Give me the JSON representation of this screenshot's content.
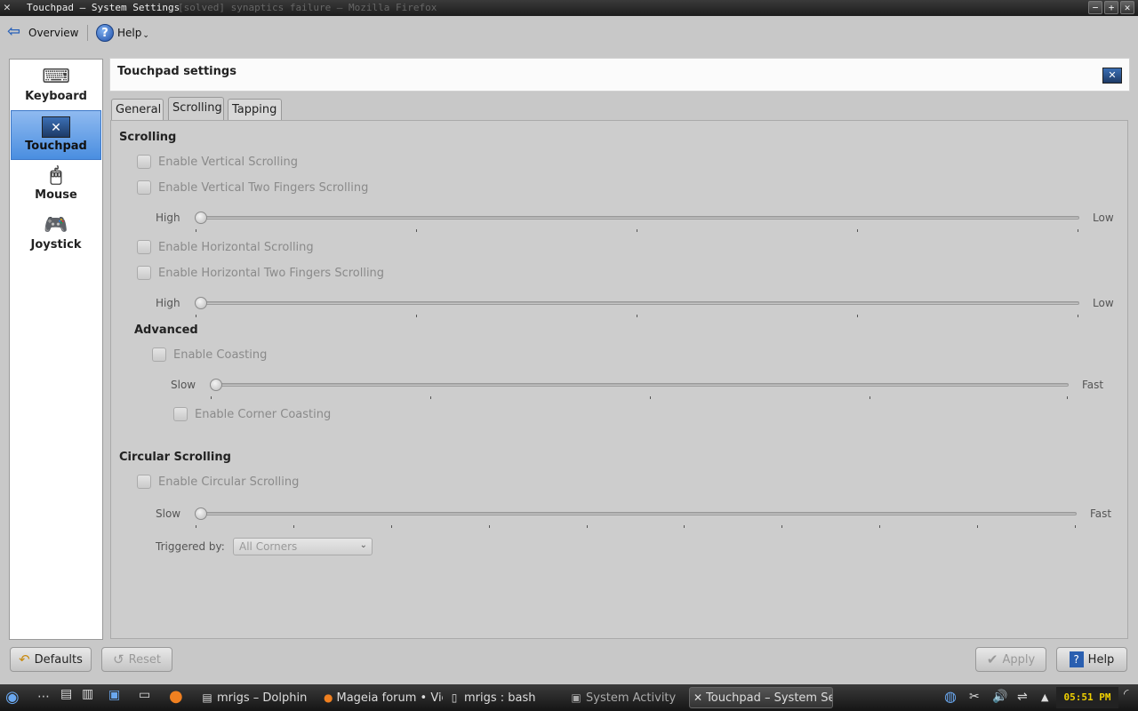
{
  "window": {
    "title": "Touchpad – System Settings",
    "ghost_title": "[solved] synaptics failure – Mozilla Firefox",
    "controls": [
      "−",
      "+",
      "✕"
    ]
  },
  "toolbar": {
    "overview_label": "Overview",
    "help_label": "Help"
  },
  "sidebar": {
    "items": [
      {
        "label": "Keyboard",
        "icon": "keyboard-icon"
      },
      {
        "label": "Touchpad",
        "icon": "touchpad-icon",
        "active": true
      },
      {
        "label": "Mouse",
        "icon": "mouse-icon"
      },
      {
        "label": "Joystick",
        "icon": "joystick-icon"
      }
    ]
  },
  "header": {
    "title": "Touchpad settings"
  },
  "tabs": [
    {
      "label": "General"
    },
    {
      "label": "Scrolling",
      "active": true
    },
    {
      "label": "Tapping"
    }
  ],
  "scrolling": {
    "section_title": "Scrolling",
    "vertical_scrolling": "Enable Vertical Scrolling",
    "vertical_two_fingers": "Enable Vertical Two Fingers Scrolling",
    "vertical_slider": {
      "min_label": "High",
      "max_label": "Low",
      "value": 0
    },
    "horizontal_scrolling": "Enable Horizontal Scrolling",
    "horizontal_two_fingers": "Enable Horizontal Two Fingers Scrolling",
    "horizontal_slider": {
      "min_label": "High",
      "max_label": "Low",
      "value": 0
    }
  },
  "advanced": {
    "section_title": "Advanced",
    "coasting": "Enable Coasting",
    "coasting_slider": {
      "min_label": "Slow",
      "max_label": "Fast",
      "value": 0
    },
    "corner_coasting": "Enable Corner Coasting"
  },
  "circular": {
    "section_title": "Circular Scrolling",
    "enable": "Enable Circular Scrolling",
    "slider": {
      "min_label": "Slow",
      "max_label": "Fast",
      "value": 0
    },
    "triggered_label": "Triggered by:",
    "triggered_value": "All Corners"
  },
  "buttons": {
    "defaults": "Defaults",
    "reset": "Reset",
    "apply": "Apply",
    "help": "Help"
  },
  "taskbar": {
    "tasks": [
      {
        "label": "mrigs – Dolphin"
      },
      {
        "label": "Mageia forum • Vie"
      },
      {
        "label": "mrigs : bash"
      },
      {
        "label": "System Activity"
      },
      {
        "label": "Touchpad – System Se"
      }
    ],
    "clock": "05:51 PM"
  }
}
